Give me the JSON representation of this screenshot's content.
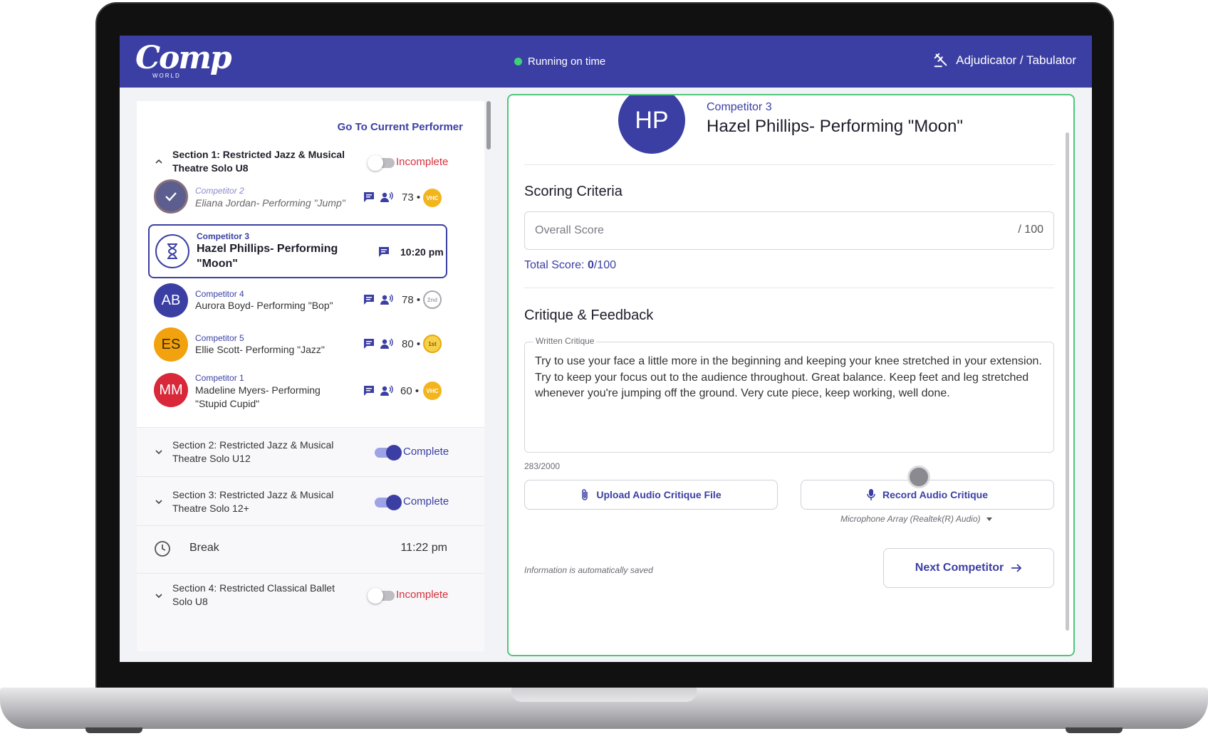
{
  "app": {
    "logo_text": "Comp",
    "logo_sub": "WORLD",
    "status": "Running on time",
    "role": "Adjudicator / Tabulator",
    "colors": {
      "brand": "#3b3fa3",
      "status_ok": "#3ed07b",
      "incomplete": "#d6313c",
      "active_border": "#4ec77a"
    }
  },
  "sidebar": {
    "goto_label": "Go To Current Performer",
    "section1": {
      "title": "Section 1: Restricted Jazz & Musical Theatre Solo U8",
      "status": "Incomplete",
      "competitors": [
        {
          "number": "Competitor 2",
          "name": "Eliana Jordan- Performing \"Jump\"",
          "initials": "",
          "score": "73 •",
          "badge": "VHC",
          "state": "done"
        },
        {
          "number": "Competitor 3",
          "name": "Hazel Phillips- Performing \"Moon\"",
          "initials": "",
          "time": "10:20 pm",
          "state": "current"
        },
        {
          "number": "Competitor 4",
          "name": "Aurora Boyd- Performing \"Bop\"",
          "initials": "AB",
          "score": "78 •",
          "badge": "2nd"
        },
        {
          "number": "Competitor 5",
          "name": "Ellie Scott- Performing \"Jazz\"",
          "initials": "ES",
          "score": "80 •",
          "badge": "1st"
        },
        {
          "number": "Competitor 1",
          "name": "Madeline Myers- Performing \"Stupid Cupid\"",
          "initials": "MM",
          "score": "60 •",
          "badge": "VHC"
        }
      ]
    },
    "section2": {
      "title": "Section 2: Restricted Jazz & Musical Theatre Solo U12",
      "status": "Complete"
    },
    "section3": {
      "title": "Section 3: Restricted Jazz & Musical Theatre Solo 12+",
      "status": "Complete"
    },
    "break": {
      "label": "Break",
      "time": "11:22 pm"
    },
    "section4": {
      "title": "Section 4: Restricted Classical Ballet Solo U8",
      "status": "Incomplete"
    }
  },
  "main": {
    "initials": "HP",
    "competitor_number": "Competitor 3",
    "competitor_name": "Hazel Phillips- Performing \"Moon\"",
    "scoring_title": "Scoring Criteria",
    "score_placeholder": "Overall Score",
    "score_max": "/ 100",
    "total_label": "Total Score:",
    "total_value": "0",
    "total_max": "/100",
    "critique_title": "Critique & Feedback",
    "critique_label": "Written Critique",
    "critique_text": "Try to use your face a little more in the beginning and keeping your knee stretched in your extension. Try to keep your focus out to the audience throughout. Great balance. Keep feet and leg stretched whenever you're jumping off the ground. Very cute piece, keep working, well done.",
    "char_count": "283/2000",
    "upload_label": "Upload Audio Critique File",
    "record_label": "Record Audio Critique",
    "mic_option": "Microphone Array (Realtek(R) Audio)",
    "autosave_note": "Information is automatically saved",
    "next_label": "Next Competitor"
  }
}
